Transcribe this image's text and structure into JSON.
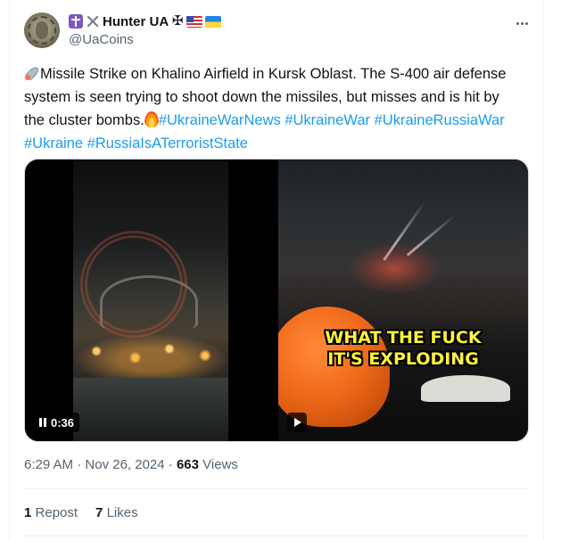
{
  "author": {
    "display_name": "Hunter UA",
    "handle": "@UaCoins",
    "name_emoji_icons": [
      "orthodox-cross-icon",
      "crossed-swords-icon",
      "iron-cross-icon",
      "us-flag-icon",
      "ukraine-flag-icon"
    ],
    "name_emoji_glyphs": {
      "iron_cross": "✠"
    }
  },
  "tweet": {
    "text_main": "Missile Strike on Khalino Airfield in Kursk Oblast.  The S-400 air defense system is seen trying to shoot down the missiles, but misses and is hit by the cluster bombs.",
    "hashtags": [
      "#UkraineWarNews",
      "#UkraineWar",
      "#UkraineRussiaWar",
      "#Ukraine",
      "#RussiaIsATerroristState"
    ],
    "leading_icon": "rocket-icon",
    "trailing_icon": "fire-icon"
  },
  "media": {
    "video1": {
      "duration": "0:36",
      "state_icon": "pause-icon"
    },
    "video2": {
      "caption_line1": "WHAT THE FUCK",
      "caption_line2": "IT'S EXPLODING",
      "state_icon": "play-icon"
    }
  },
  "meta": {
    "time": "6:29 AM",
    "separator": "·",
    "date": "Nov 26, 2024",
    "views_count": "663",
    "views_label": "Views"
  },
  "stats": {
    "reposts_count": "1",
    "reposts_label": "Repost",
    "likes_count": "7",
    "likes_label": "Likes"
  },
  "colors": {
    "link": "#1d9bf0",
    "text": "#0f1419",
    "secondary": "#536471",
    "caption": "#fff33a"
  }
}
